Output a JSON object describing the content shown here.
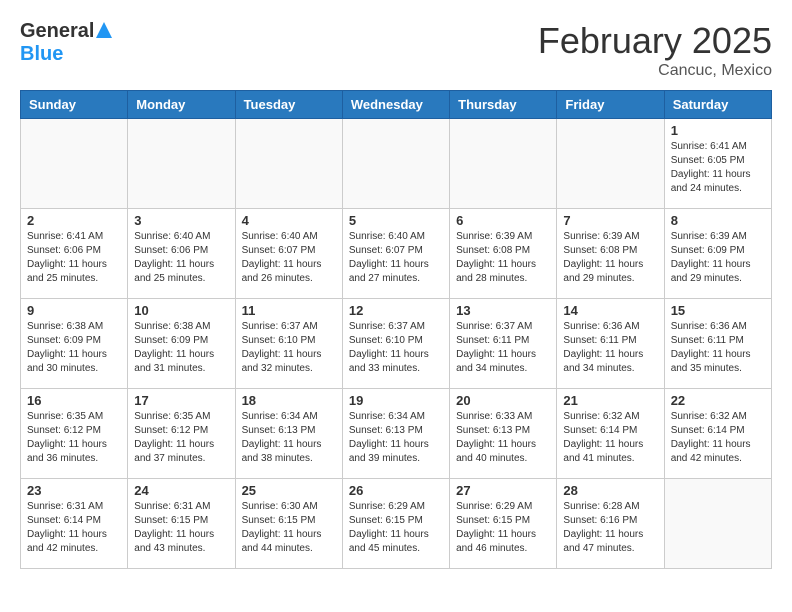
{
  "header": {
    "logo_general": "General",
    "logo_blue": "Blue",
    "month_year": "February 2025",
    "location": "Cancuc, Mexico"
  },
  "days_of_week": [
    "Sunday",
    "Monday",
    "Tuesday",
    "Wednesday",
    "Thursday",
    "Friday",
    "Saturday"
  ],
  "weeks": [
    [
      {
        "day": "",
        "info": ""
      },
      {
        "day": "",
        "info": ""
      },
      {
        "day": "",
        "info": ""
      },
      {
        "day": "",
        "info": ""
      },
      {
        "day": "",
        "info": ""
      },
      {
        "day": "",
        "info": ""
      },
      {
        "day": "1",
        "info": "Sunrise: 6:41 AM\nSunset: 6:05 PM\nDaylight: 11 hours\nand 24 minutes."
      }
    ],
    [
      {
        "day": "2",
        "info": "Sunrise: 6:41 AM\nSunset: 6:06 PM\nDaylight: 11 hours\nand 25 minutes."
      },
      {
        "day": "3",
        "info": "Sunrise: 6:40 AM\nSunset: 6:06 PM\nDaylight: 11 hours\nand 25 minutes."
      },
      {
        "day": "4",
        "info": "Sunrise: 6:40 AM\nSunset: 6:07 PM\nDaylight: 11 hours\nand 26 minutes."
      },
      {
        "day": "5",
        "info": "Sunrise: 6:40 AM\nSunset: 6:07 PM\nDaylight: 11 hours\nand 27 minutes."
      },
      {
        "day": "6",
        "info": "Sunrise: 6:39 AM\nSunset: 6:08 PM\nDaylight: 11 hours\nand 28 minutes."
      },
      {
        "day": "7",
        "info": "Sunrise: 6:39 AM\nSunset: 6:08 PM\nDaylight: 11 hours\nand 29 minutes."
      },
      {
        "day": "8",
        "info": "Sunrise: 6:39 AM\nSunset: 6:09 PM\nDaylight: 11 hours\nand 29 minutes."
      }
    ],
    [
      {
        "day": "9",
        "info": "Sunrise: 6:38 AM\nSunset: 6:09 PM\nDaylight: 11 hours\nand 30 minutes."
      },
      {
        "day": "10",
        "info": "Sunrise: 6:38 AM\nSunset: 6:09 PM\nDaylight: 11 hours\nand 31 minutes."
      },
      {
        "day": "11",
        "info": "Sunrise: 6:37 AM\nSunset: 6:10 PM\nDaylight: 11 hours\nand 32 minutes."
      },
      {
        "day": "12",
        "info": "Sunrise: 6:37 AM\nSunset: 6:10 PM\nDaylight: 11 hours\nand 33 minutes."
      },
      {
        "day": "13",
        "info": "Sunrise: 6:37 AM\nSunset: 6:11 PM\nDaylight: 11 hours\nand 34 minutes."
      },
      {
        "day": "14",
        "info": "Sunrise: 6:36 AM\nSunset: 6:11 PM\nDaylight: 11 hours\nand 34 minutes."
      },
      {
        "day": "15",
        "info": "Sunrise: 6:36 AM\nSunset: 6:11 PM\nDaylight: 11 hours\nand 35 minutes."
      }
    ],
    [
      {
        "day": "16",
        "info": "Sunrise: 6:35 AM\nSunset: 6:12 PM\nDaylight: 11 hours\nand 36 minutes."
      },
      {
        "day": "17",
        "info": "Sunrise: 6:35 AM\nSunset: 6:12 PM\nDaylight: 11 hours\nand 37 minutes."
      },
      {
        "day": "18",
        "info": "Sunrise: 6:34 AM\nSunset: 6:13 PM\nDaylight: 11 hours\nand 38 minutes."
      },
      {
        "day": "19",
        "info": "Sunrise: 6:34 AM\nSunset: 6:13 PM\nDaylight: 11 hours\nand 39 minutes."
      },
      {
        "day": "20",
        "info": "Sunrise: 6:33 AM\nSunset: 6:13 PM\nDaylight: 11 hours\nand 40 minutes."
      },
      {
        "day": "21",
        "info": "Sunrise: 6:32 AM\nSunset: 6:14 PM\nDaylight: 11 hours\nand 41 minutes."
      },
      {
        "day": "22",
        "info": "Sunrise: 6:32 AM\nSunset: 6:14 PM\nDaylight: 11 hours\nand 42 minutes."
      }
    ],
    [
      {
        "day": "23",
        "info": "Sunrise: 6:31 AM\nSunset: 6:14 PM\nDaylight: 11 hours\nand 42 minutes."
      },
      {
        "day": "24",
        "info": "Sunrise: 6:31 AM\nSunset: 6:15 PM\nDaylight: 11 hours\nand 43 minutes."
      },
      {
        "day": "25",
        "info": "Sunrise: 6:30 AM\nSunset: 6:15 PM\nDaylight: 11 hours\nand 44 minutes."
      },
      {
        "day": "26",
        "info": "Sunrise: 6:29 AM\nSunset: 6:15 PM\nDaylight: 11 hours\nand 45 minutes."
      },
      {
        "day": "27",
        "info": "Sunrise: 6:29 AM\nSunset: 6:15 PM\nDaylight: 11 hours\nand 46 minutes."
      },
      {
        "day": "28",
        "info": "Sunrise: 6:28 AM\nSunset: 6:16 PM\nDaylight: 11 hours\nand 47 minutes."
      },
      {
        "day": "",
        "info": ""
      }
    ]
  ]
}
